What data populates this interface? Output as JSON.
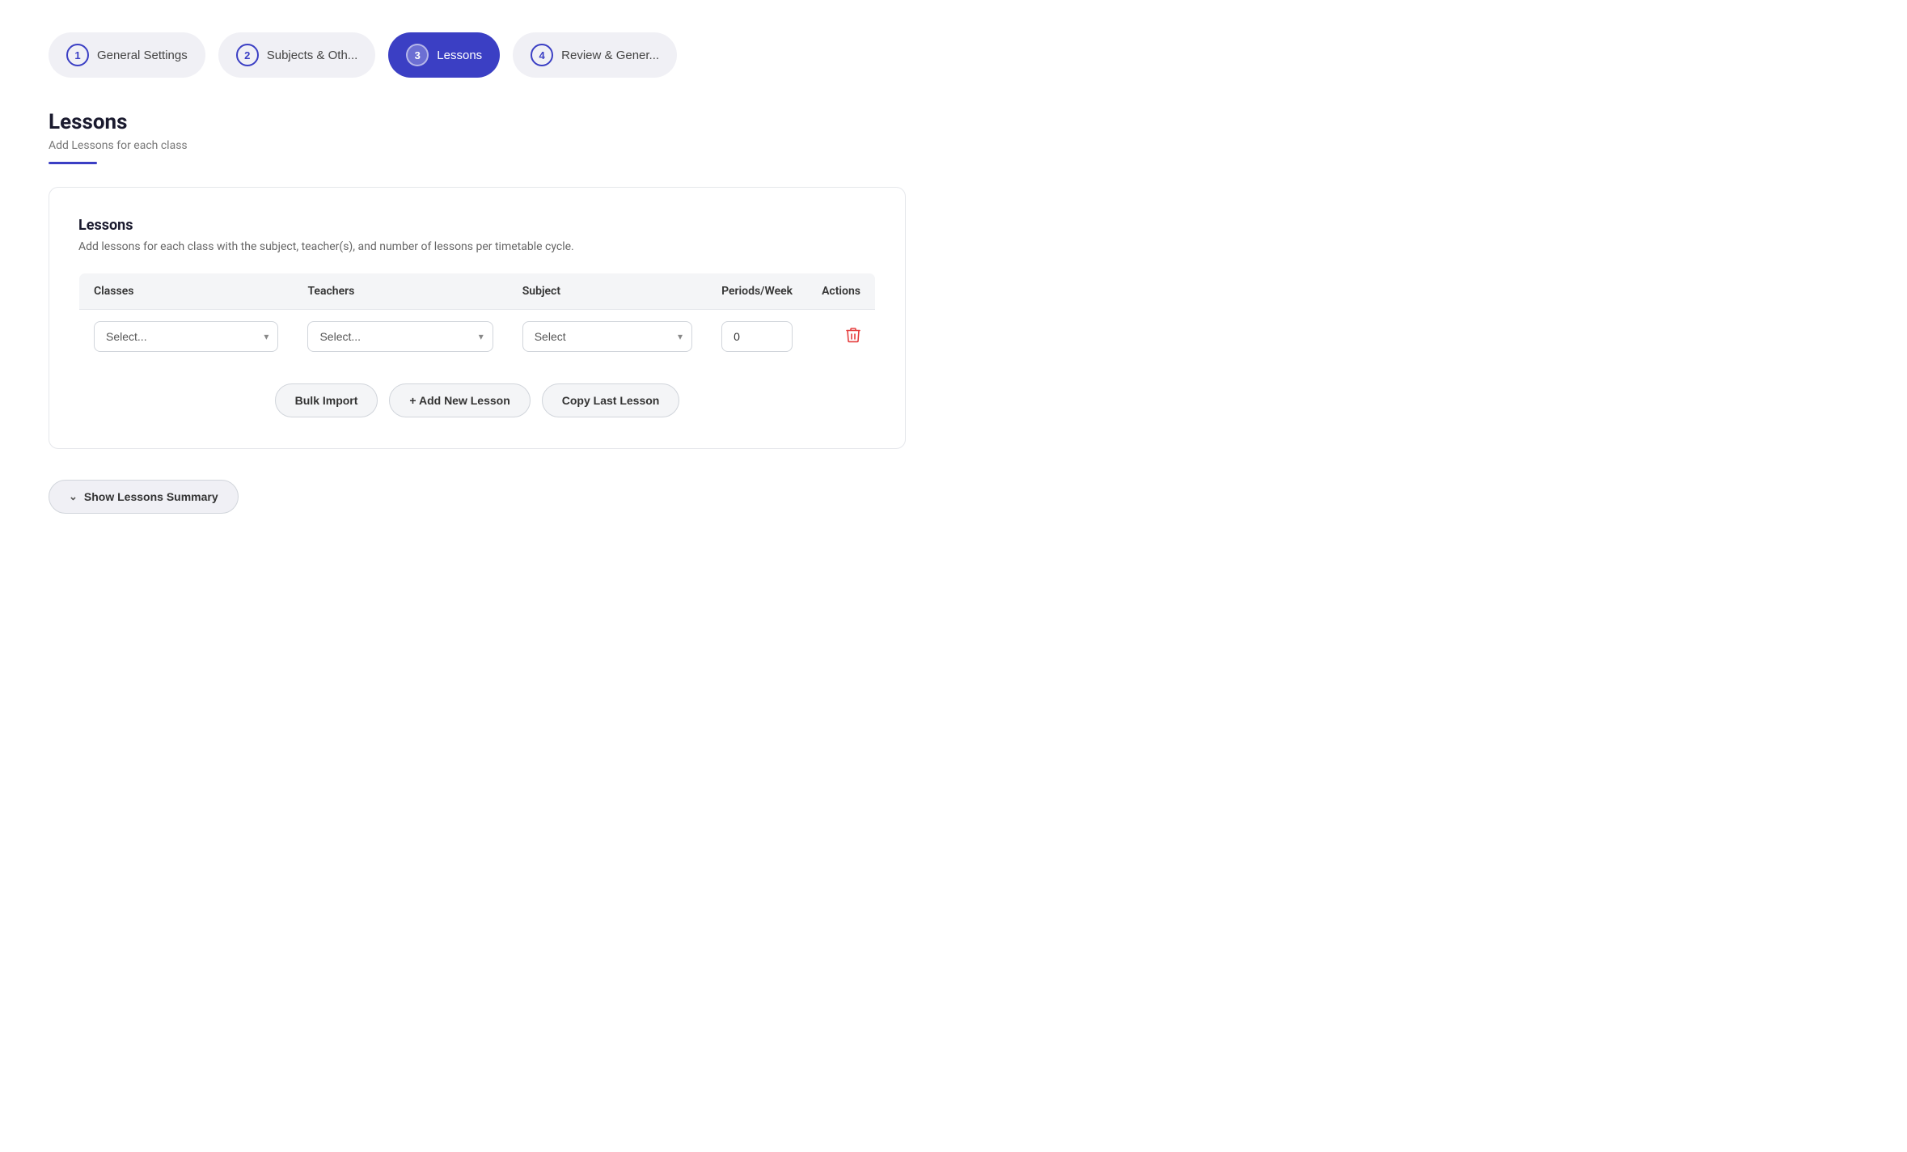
{
  "stepper": {
    "steps": [
      {
        "number": "1",
        "label": "General Settings",
        "active": false
      },
      {
        "number": "2",
        "label": "Subjects & Oth...",
        "active": false
      },
      {
        "number": "3",
        "label": "Lessons",
        "active": true
      },
      {
        "number": "4",
        "label": "Review & Gener...",
        "active": false
      }
    ]
  },
  "page": {
    "title": "Lessons",
    "subtitle": "Add Lessons for each class"
  },
  "card": {
    "title": "Lessons",
    "description": "Add lessons for each class with the subject, teacher(s), and number of lessons per timetable cycle.",
    "table": {
      "headers": [
        "Classes",
        "Teachers",
        "Subject",
        "Periods/Week",
        "Actions"
      ],
      "rows": [
        {
          "classes_placeholder": "Select...",
          "teachers_placeholder": "Select...",
          "subject_placeholder": "Select",
          "periods_value": "0"
        }
      ]
    },
    "buttons": {
      "bulk_import": "Bulk Import",
      "add_lesson": "+ Add New Lesson",
      "copy_last": "Copy Last Lesson"
    }
  },
  "summary_button": {
    "label": "Show Lessons Summary",
    "chevron": "chevron-down-icon"
  }
}
